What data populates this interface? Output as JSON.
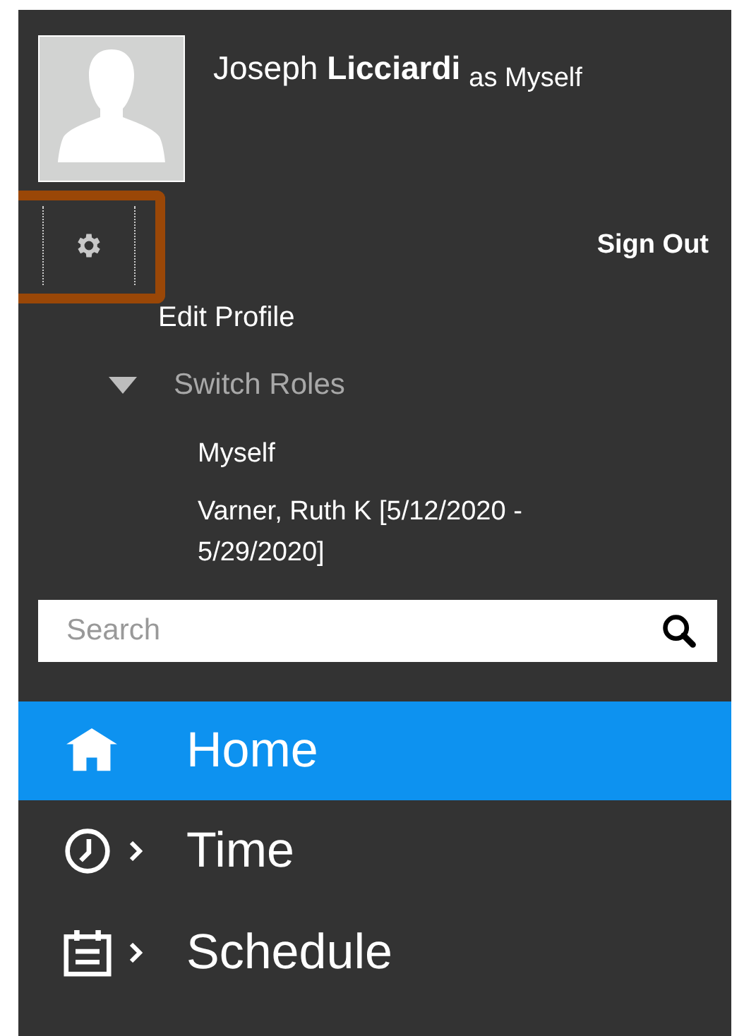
{
  "profile": {
    "name": "Joseph **Licciardi**",
    "role": "as Myself",
    "sign_out": "Sign Out"
  },
  "menu": {
    "edit_profile": "Edit Profile",
    "switch_roles": {
      "label": "Switch Roles",
      "expanded": true,
      "roles": [
        "Myself",
        "Varner, Ruth K [5/12/2020 - 5/29/2020]"
      ]
    }
  },
  "search": {
    "placeholder": "Search"
  },
  "nav": [
    {
      "kind": "home",
      "label": "Home",
      "selected": true,
      "has_submenu": false
    },
    {
      "kind": "clock",
      "label": "Time",
      "selected": false,
      "has_submenu": true
    },
    {
      "kind": "calendar",
      "label": "Schedule",
      "selected": false,
      "has_submenu": true
    }
  ]
}
